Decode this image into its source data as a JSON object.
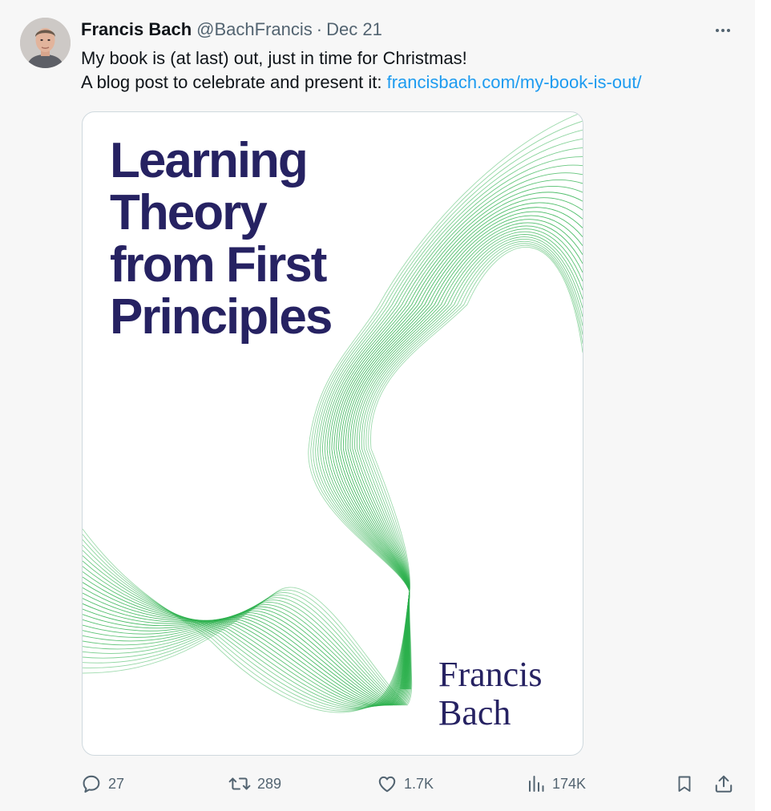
{
  "tweet": {
    "author": {
      "name": "Francis Bach",
      "handle": "@BachFrancis",
      "separator": "·",
      "date": "Dec 21"
    },
    "text": {
      "line1": "My book is (at last) out, just in time for Christmas!",
      "line2_prefix": "A blog post to celebrate and present it: ",
      "link": "francisbach.com/my-book-is-out/"
    },
    "media": {
      "title_lines": [
        "Learning",
        "Theory",
        "from First",
        "Principles"
      ],
      "author_lines": [
        "Francis",
        "Bach"
      ],
      "colors": {
        "title": "#262262",
        "waves": "#2bb04c"
      }
    },
    "actions": {
      "replies": "27",
      "reposts": "289",
      "likes": "1.7K",
      "views": "174K"
    },
    "icons": [
      "more-icon",
      "reply-icon",
      "repost-icon",
      "like-icon",
      "views-icon",
      "bookmark-icon",
      "share-icon"
    ],
    "colors": {
      "link": "#1d9bf0",
      "muted": "#536471",
      "text": "#0f1419",
      "background": "#f7f7f7"
    }
  }
}
